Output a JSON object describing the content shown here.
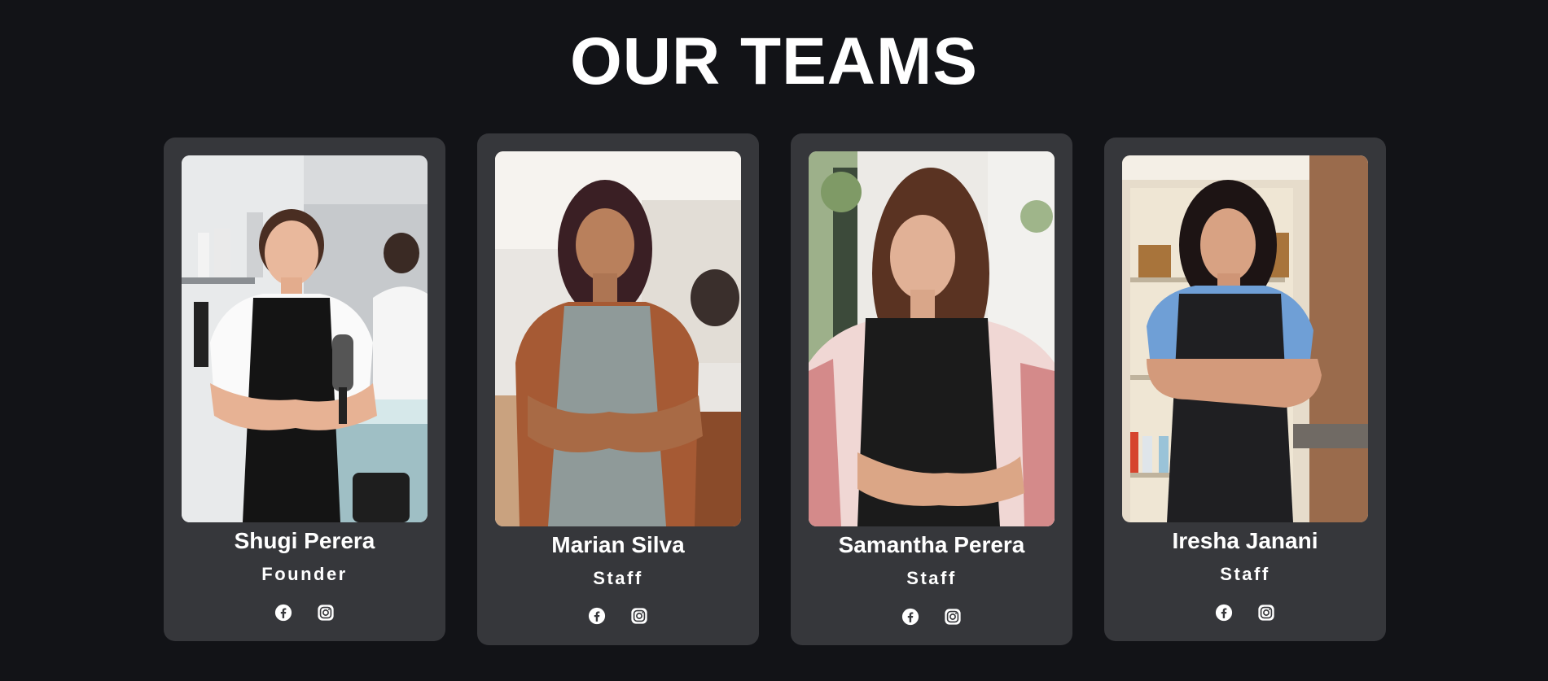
{
  "section": {
    "title": "OUR TEAMS"
  },
  "colors": {
    "background": "#121317",
    "card": "#36373b",
    "text": "#ffffff"
  },
  "members": [
    {
      "name": "Shugi Perera",
      "role": "Founder",
      "socials": [
        "facebook-icon",
        "instagram-icon"
      ]
    },
    {
      "name": "Marian Silva",
      "role": "Staff",
      "socials": [
        "facebook-icon",
        "instagram-icon"
      ]
    },
    {
      "name": "Samantha Perera",
      "role": "Staff",
      "socials": [
        "facebook-icon",
        "instagram-icon"
      ]
    },
    {
      "name": "Iresha Janani",
      "role": "Staff",
      "socials": [
        "facebook-icon",
        "instagram-icon"
      ]
    }
  ]
}
